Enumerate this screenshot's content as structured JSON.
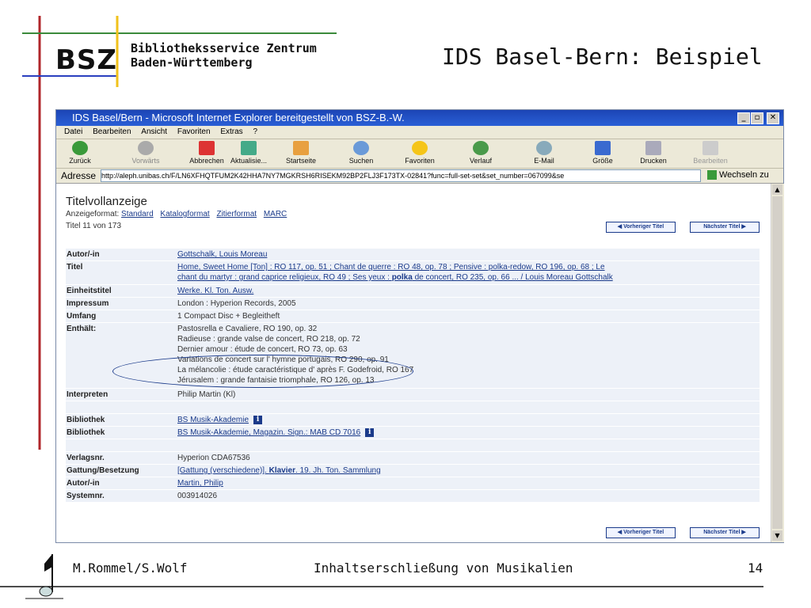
{
  "slide": {
    "logo": "BSZ",
    "logo_sub_line1": "Bibliotheksservice Zentrum",
    "logo_sub_line2": "Baden-Württemberg",
    "title": "IDS Basel-Bern: Beispiel",
    "footer_left": "M.Rommel/S.Wolf",
    "footer_center": "Inhaltserschließung von Musikalien",
    "footer_page": "14"
  },
  "browser": {
    "title": "IDS Basel/Bern - Microsoft Internet Explorer bereitgestellt von BSZ-B.-W.",
    "menu": [
      "Datei",
      "Bearbeiten",
      "Ansicht",
      "Favoriten",
      "Extras",
      "?"
    ],
    "toolbar": [
      "Zurück",
      "Vorwärts",
      "Abbrechen",
      "Aktualisie...",
      "Startseite",
      "Suchen",
      "Favoriten",
      "Verlauf",
      "E-Mail",
      "Größe",
      "Drucken",
      "Bearbeiten"
    ],
    "address_label": "Adresse",
    "address": "http://aleph.unibas.ch/F/LN6XFHQTFUM2K42HHA7NY7MGKRSH6RISEKM92BP2FLJ3F173TX-02841?func=full-set-set&set_number=067099&se",
    "go_label": "Wechseln zu"
  },
  "page": {
    "heading": "Titelvollanzeige",
    "format_label": "Anzeigeformat:",
    "formats": [
      "Standard",
      "Katalogformat",
      "Zitierformat",
      "MARC"
    ],
    "count": "Titel 11 von 173",
    "prev": "◀ Vorheriger Titel",
    "next": "Nächster Titel ▶"
  },
  "record": {
    "autor": {
      "k": "Autor/-in",
      "v": "Gottschalk, Louis Moreau"
    },
    "titel": {
      "k": "Titel",
      "v1": "Home, Sweet Home [Ton] : RO 117, op. 51 ; Chant de querre : RO 48, op. 78 ; Pensive : polka-redow, RO 196, op. 68 ; Le",
      "v2a": "chant du martyr : grand caprice religieux, RO 49 ; Ses yeux : ",
      "v2b": "polka",
      "v2c": " de concert, RO 235, op. 66 ... / Louis Moreau Gottschalk"
    },
    "einheit": {
      "k": "Einheitstitel",
      "v": "Werke. Kl. Ton. Ausw."
    },
    "impressum": {
      "k": "Impressum",
      "v": "London : Hyperion Records, 2005"
    },
    "umfang": {
      "k": "Umfang",
      "v": "1 Compact Disc + Begleitheft"
    },
    "enthaelt": {
      "k": "Enthält:",
      "lines": [
        "Pastosrella e Cavaliere, RO 190, op. 32",
        "Radieuse : grande valse de concert, RO 218, op. 72",
        "Dernier amour : étude de concert, RO 73, op. 63",
        "Variations de concert sur l' hymne portugais, RO 290, op. 91",
        "La mélancolie : étude caractéristique d' après F. Godefroid, RO 167",
        "Jérusalem : grande fantaisie triomphale, RO 126, op. 13"
      ]
    },
    "interpreten": {
      "k": "Interpreten",
      "v": "Philip Martin (Kl)"
    },
    "bib1": {
      "k": "Bibliothek",
      "v": "BS Musik-Akademie"
    },
    "bib2": {
      "k": "Bibliothek",
      "v": "BS Musik-Akademie, Magazin. Sign.: MAB CD 7016"
    },
    "verlag": {
      "k": "Verlagsnr.",
      "v": "Hyperion CDA67536"
    },
    "gattung": {
      "k": "Gattung/Besetzung",
      "va": "[Gattung (verschiedene)]. ",
      "vb": "Klavier",
      "vc": ". 19. Jh. Ton. Sammlung"
    },
    "autor2": {
      "k": "Autor/-in",
      "v": "Martin, Philip"
    },
    "system": {
      "k": "Systemnr.",
      "v": "003914026"
    }
  },
  "colors": {
    "accent_line_red": "#b0262a",
    "accent_line_green": "#3b8a3b",
    "accent_line_yellow": "#f1c21b",
    "titlebar": "#2a5fd6",
    "link": "#1a3a8a"
  }
}
